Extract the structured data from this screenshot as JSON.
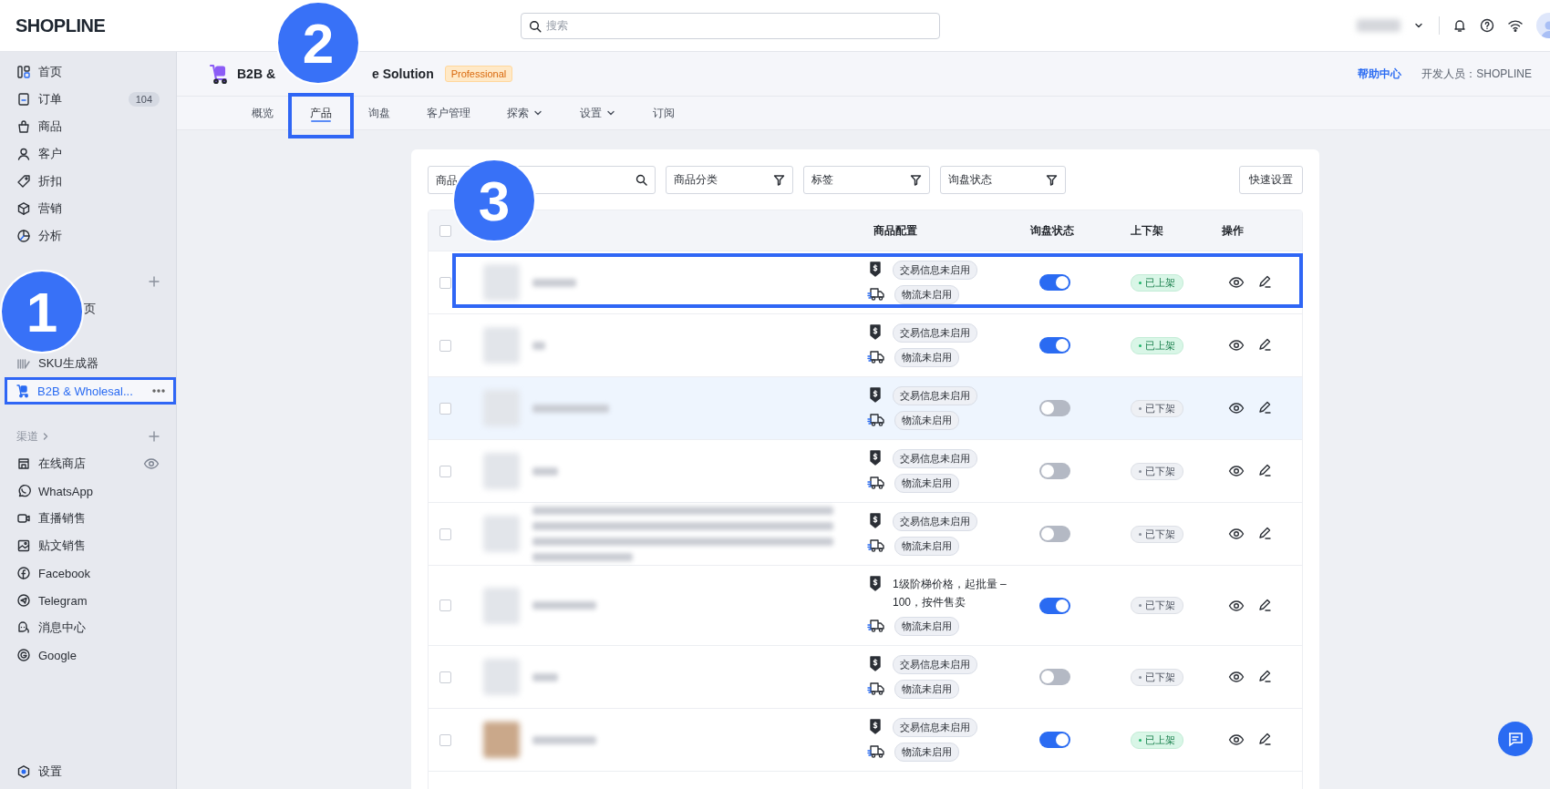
{
  "topbar": {
    "logo": "SHOPLINE",
    "search": {
      "placeholder": "搜索"
    }
  },
  "sidebar": {
    "nav": [
      {
        "label": "首页",
        "selected": false
      },
      {
        "label": "订单",
        "badge": "104",
        "selected": false
      },
      {
        "label": "商品",
        "selected": false
      },
      {
        "label": "客户",
        "selected": false
      },
      {
        "label": "折扣",
        "selected": false
      },
      {
        "label": "营销",
        "selected": false
      },
      {
        "label": "分析",
        "selected": false
      }
    ],
    "apps": [
      {
        "label": "页",
        "selected": false,
        "annotated": false
      },
      {
        "label": "SKU生成器",
        "selected": false,
        "annotated": false
      },
      {
        "label": "B2B & Wholesal...",
        "selected": true,
        "annotated": true
      }
    ],
    "channels": {
      "title": "渠道",
      "items": [
        {
          "label": "在线商店",
          "selected": false
        },
        {
          "label": "WhatsApp",
          "selected": false
        },
        {
          "label": "直播销售",
          "selected": false
        },
        {
          "label": "贴文销售",
          "selected": false
        },
        {
          "label": "Facebook",
          "selected": false
        },
        {
          "label": "Telegram",
          "selected": false
        },
        {
          "label": "消息中心",
          "selected": false
        },
        {
          "label": "Google",
          "selected": false
        }
      ]
    },
    "settings": {
      "label": "设置"
    }
  },
  "app_header": {
    "title_start": "B2B &",
    "title_end": "e Solution",
    "plan": "Professional",
    "help": "帮助中心",
    "developer": "开发人员：SHOPLINE"
  },
  "tabs": [
    {
      "label": "概览",
      "selected": false,
      "dropdown": false,
      "annotated": false
    },
    {
      "label": "产品",
      "selected": true,
      "dropdown": false,
      "annotated": true
    },
    {
      "label": "询盘",
      "selected": false,
      "dropdown": false,
      "annotated": false
    },
    {
      "label": "客户管理",
      "selected": false,
      "dropdown": false,
      "annotated": false
    },
    {
      "label": "探索",
      "selected": false,
      "dropdown": true,
      "annotated": false
    },
    {
      "label": "设置",
      "selected": false,
      "dropdown": true,
      "annotated": false
    },
    {
      "label": "订阅",
      "selected": false,
      "dropdown": false,
      "annotated": false
    }
  ],
  "filters": {
    "search": {
      "placeholder": "商品"
    },
    "dropdowns": [
      "商品分类",
      "标签",
      "询盘状态"
    ],
    "quick_settings": "快速设置"
  },
  "table": {
    "header_checked": false,
    "columns": [
      "商品配置",
      "询盘状态",
      "上下架",
      "操作"
    ],
    "rows": [
      {
        "checked": false,
        "highlighted": false,
        "annotated": true,
        "config": [
          {
            "kind": "price",
            "text": "交易信息未启用",
            "tag": true
          },
          {
            "kind": "shipping",
            "text": "物流未启用",
            "tag": true
          }
        ],
        "inquiry": true,
        "status": {
          "label": "已上架",
          "listed": true
        }
      },
      {
        "checked": false,
        "highlighted": false,
        "annotated": false,
        "config": [
          {
            "kind": "price",
            "text": "交易信息未启用",
            "tag": true
          },
          {
            "kind": "shipping",
            "text": "物流未启用",
            "tag": true
          }
        ],
        "inquiry": true,
        "status": {
          "label": "已上架",
          "listed": true
        }
      },
      {
        "checked": false,
        "highlighted": true,
        "annotated": false,
        "config": [
          {
            "kind": "price",
            "text": "交易信息未启用",
            "tag": true
          },
          {
            "kind": "shipping",
            "text": "物流未启用",
            "tag": true
          }
        ],
        "inquiry": false,
        "status": {
          "label": "已下架",
          "listed": false
        }
      },
      {
        "checked": false,
        "highlighted": false,
        "annotated": false,
        "config": [
          {
            "kind": "price",
            "text": "交易信息未启用",
            "tag": true
          },
          {
            "kind": "shipping",
            "text": "物流未启用",
            "tag": true
          }
        ],
        "inquiry": false,
        "status": {
          "label": "已下架",
          "listed": false
        }
      },
      {
        "checked": false,
        "highlighted": false,
        "annotated": false,
        "config": [
          {
            "kind": "price",
            "text": "交易信息未启用",
            "tag": true
          },
          {
            "kind": "shipping",
            "text": "物流未启用",
            "tag": true
          }
        ],
        "inquiry": false,
        "status": {
          "label": "已下架",
          "listed": false
        }
      },
      {
        "checked": false,
        "highlighted": false,
        "annotated": false,
        "config": [
          {
            "kind": "price",
            "text": "1级阶梯价格，起批量 – 100，按件售卖",
            "tag": false
          },
          {
            "kind": "shipping",
            "text": "物流未启用",
            "tag": true
          }
        ],
        "inquiry": true,
        "status": {
          "label": "已下架",
          "listed": false
        }
      },
      {
        "checked": false,
        "highlighted": false,
        "annotated": false,
        "config": [
          {
            "kind": "price",
            "text": "交易信息未启用",
            "tag": true
          },
          {
            "kind": "shipping",
            "text": "物流未启用",
            "tag": true
          }
        ],
        "inquiry": false,
        "status": {
          "label": "已下架",
          "listed": false
        }
      },
      {
        "checked": false,
        "highlighted": false,
        "annotated": false,
        "config": [
          {
            "kind": "price",
            "text": "交易信息未启用",
            "tag": true
          },
          {
            "kind": "shipping",
            "text": "物流未启用",
            "tag": true
          }
        ],
        "inquiry": true,
        "status": {
          "label": "已上架",
          "listed": true
        }
      }
    ]
  },
  "callouts": [
    "1",
    "2",
    "3"
  ]
}
